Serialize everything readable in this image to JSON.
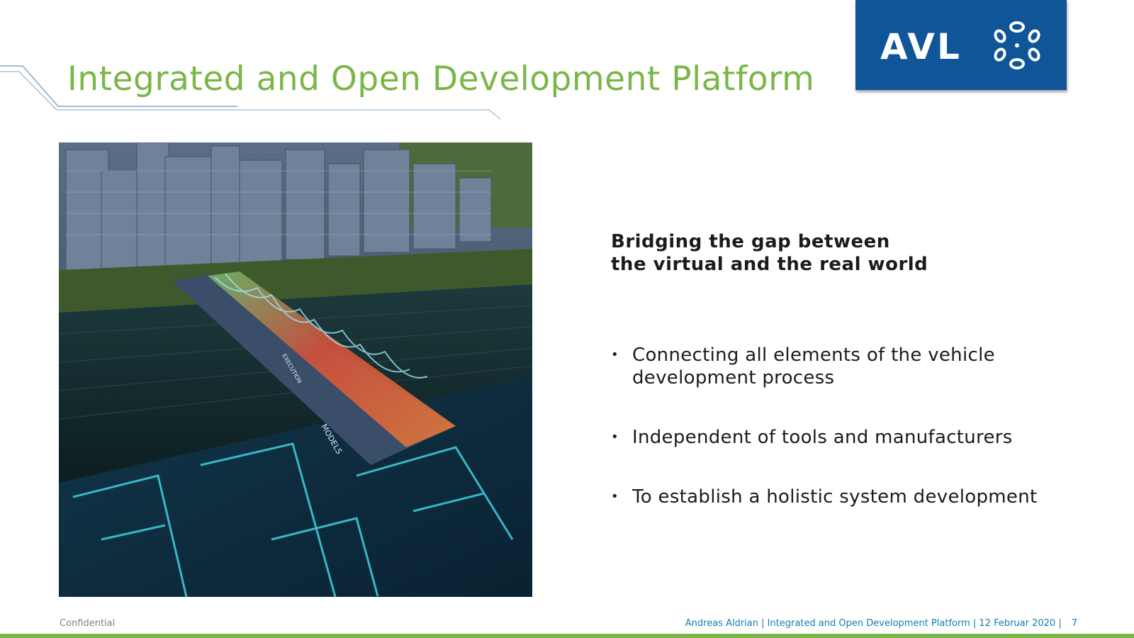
{
  "slide": {
    "title": "Integrated and Open Development Platform",
    "logo": {
      "text": "AVL",
      "mark_icon": "avl-emblem-icon",
      "background": "#0f5597"
    },
    "heading_line1": "Bridging the gap between",
    "heading_line2": "the virtual and the real world",
    "bullets": [
      "Connecting all elements of the vehicle development process",
      "Independent of tools and manufacturers",
      "To establish a holistic system development"
    ],
    "image": {
      "labels": {
        "models": "MODELS",
        "execution": "EXECUTION"
      }
    }
  },
  "footer": {
    "confidential": "Confidential",
    "info": "Andreas Aldrian | Integrated and Open Development Platform | 12 Februar 2020 |",
    "page_number": "7"
  },
  "colors": {
    "title": "#7ab648",
    "accent_blue": "#0f5597",
    "footer_info": "#0f7fa8",
    "bottom_bar": "#7ab648"
  }
}
